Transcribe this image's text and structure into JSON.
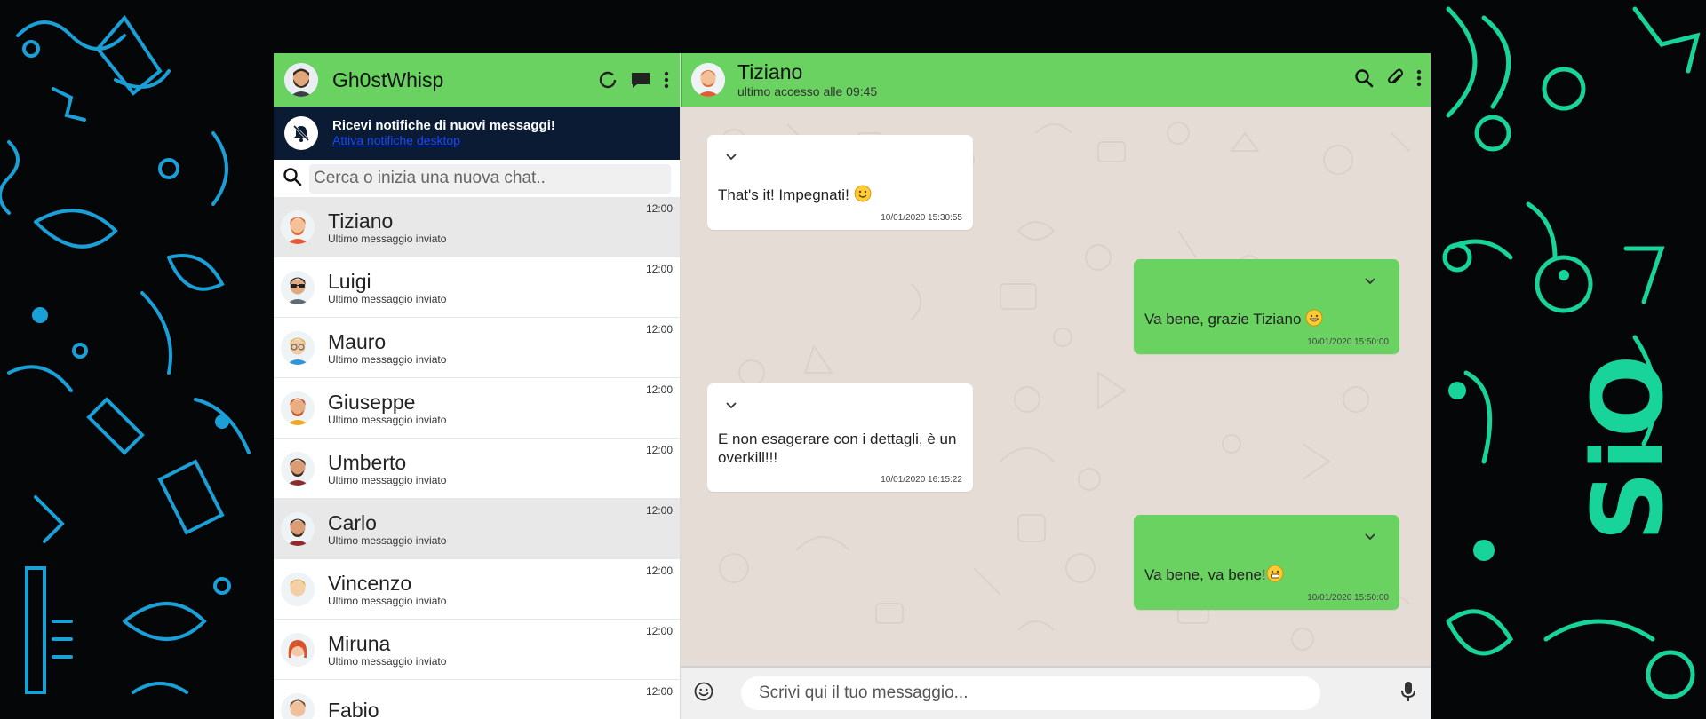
{
  "profile": {
    "name": "Gh0stWhisp"
  },
  "notification": {
    "title": "Ricevi notifiche di nuovi messaggi!",
    "link": "Attiva notifiche desktop"
  },
  "search": {
    "placeholder": "Cerca o inizia una nuova chat.."
  },
  "contacts": [
    {
      "name": "Tiziano",
      "last": "Ultimo messaggio inviato",
      "time": "12:00",
      "avatar": "red-hair-man",
      "active": true
    },
    {
      "name": "Luigi",
      "last": "Ultimo messaggio inviato",
      "time": "12:00",
      "avatar": "sunglasses-man"
    },
    {
      "name": "Mauro",
      "last": "Ultimo messaggio inviato",
      "time": "12:00",
      "avatar": "blond-glasses-man"
    },
    {
      "name": "Giuseppe",
      "last": "Ultimo messaggio inviato",
      "time": "12:00",
      "avatar": "bearded-man-yellow"
    },
    {
      "name": "Umberto",
      "last": "Ultimo messaggio inviato",
      "time": "12:00",
      "avatar": "bearded-man-dark"
    },
    {
      "name": "Carlo",
      "last": "Ultimo messaggio inviato",
      "time": "12:00",
      "avatar": "bearded-man-dark",
      "active": true
    },
    {
      "name": "Vincenzo",
      "last": "Ultimo messaggio inviato",
      "time": "12:00",
      "avatar": "blond-man"
    },
    {
      "name": "Miruna",
      "last": "Ultimo messaggio inviato",
      "time": "12:00",
      "avatar": "red-hair-woman"
    },
    {
      "name": "Fabio",
      "last": "",
      "time": "12:00",
      "avatar": "man"
    }
  ],
  "chat": {
    "name": "Tiziano",
    "status": "ultimo accesso alle 09:45"
  },
  "messages": [
    {
      "dir": "in",
      "text": "That's it! Impegnati! ",
      "emoji": "smile",
      "time": "10/01/2020 15:30:55"
    },
    {
      "dir": "out",
      "text": "Va bene, grazie Tiziano ",
      "emoji": "grin",
      "time": "10/01/2020 15:50:00"
    },
    {
      "dir": "in",
      "text": "E non esagerare con i dettagli, è un overkill!!!",
      "emoji": "",
      "time": "10/01/2020 16:15:22"
    },
    {
      "dir": "out",
      "text": "Va bene, va bene!",
      "emoji": "grimace",
      "time": "10/01/2020 15:50:00"
    }
  ],
  "compose": {
    "placeholder": "Scrivi qui il tuo messaggio..."
  },
  "colors": {
    "header_green": "#6ad261",
    "notify_bg": "#0a1b33",
    "chat_bg": "#e5ddd5",
    "wallpaper_left": "#1fa4d8",
    "wallpaper_right": "#1fd39a"
  }
}
